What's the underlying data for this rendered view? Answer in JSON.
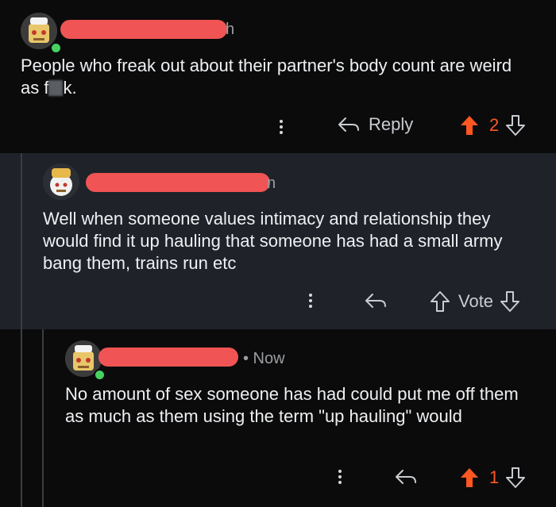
{
  "comments": [
    {
      "meta_tail": "h",
      "body": "People who freak out about their partner's body count are weird as f",
      "body_tail": "k.",
      "reply_label": "Reply",
      "vote_count": "2"
    },
    {
      "meta_tail": "n",
      "body": "Well when someone values intimacy and relationship they would find it up hauling that someone has had a small army bang them, trains run etc",
      "vote_label": "Vote"
    },
    {
      "meta_tail": "• Now",
      "body": "No amount of sex someone has had could put me off them as much as them using the term \"up hauling\" would",
      "vote_count": "1"
    }
  ],
  "colors": {
    "upvote_active": "#ff5722",
    "redaction": "#f05454",
    "online": "#46d160"
  },
  "icons": [
    "kebab-icon",
    "reply-arrow-icon",
    "upvote-arrow-icon",
    "downvote-arrow-icon"
  ]
}
